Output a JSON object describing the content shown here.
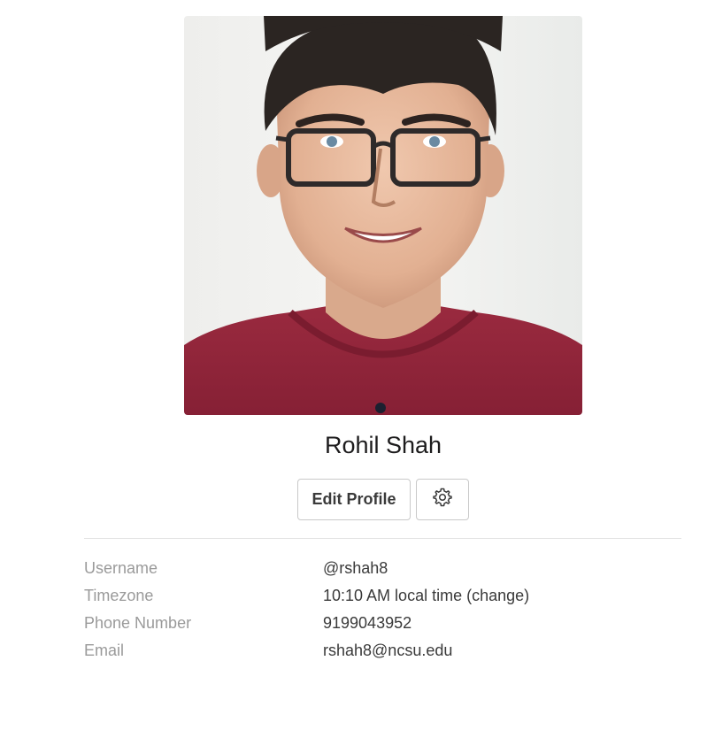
{
  "profile": {
    "name": "Rohil Shah",
    "photo_alt": "Profile photo"
  },
  "actions": {
    "edit_label": "Edit Profile",
    "settings_icon": "gear-icon"
  },
  "fields": [
    {
      "label": "Username",
      "value": "@rshah8"
    },
    {
      "label": "Timezone",
      "value": "10:10 AM local time (change)"
    },
    {
      "label": "Phone Number",
      "value": "9199043952"
    },
    {
      "label": "Email",
      "value": "rshah8@ncsu.edu"
    }
  ],
  "colors": {
    "shirt": "#8e2338",
    "hair": "#2b2522",
    "skin": "#e9bfa5",
    "background": "#f3f3f1"
  }
}
